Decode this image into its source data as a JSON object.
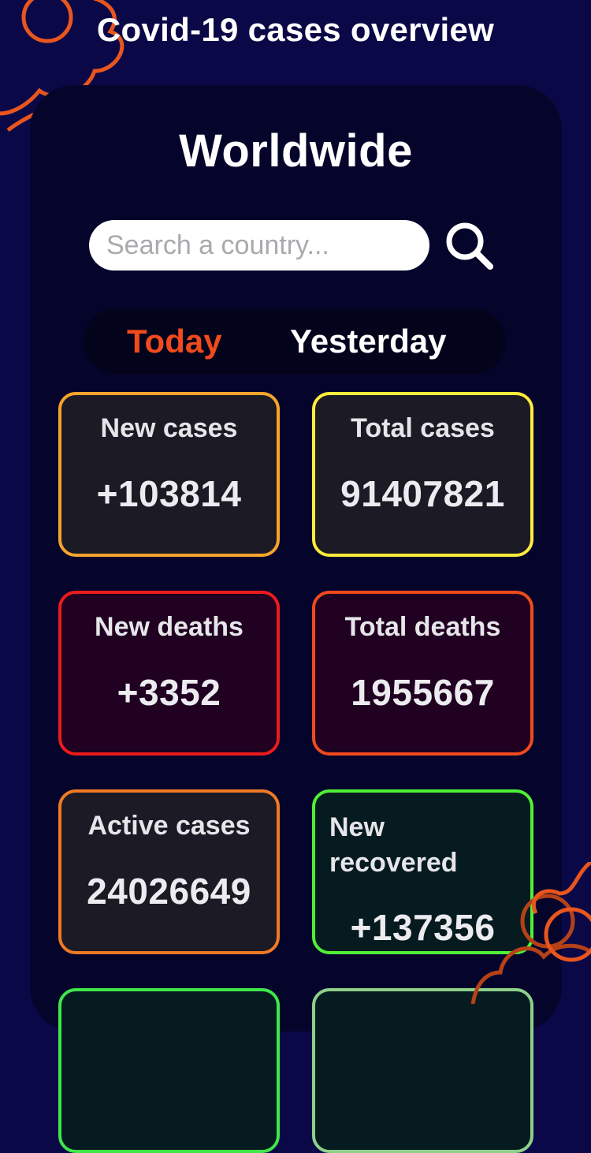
{
  "header": {
    "title": "Covid-19 cases overview"
  },
  "panel": {
    "region_title": "Worldwide"
  },
  "search": {
    "placeholder": "Search a country..."
  },
  "tabs": {
    "today": "Today",
    "yesterday": "Yesterday",
    "active": "today"
  },
  "cards": [
    {
      "label": "New cases",
      "value": "+103814",
      "color": "#f5a52c"
    },
    {
      "label": "Total cases",
      "value": "91407821",
      "color": "#ffeb3b"
    },
    {
      "label": "New deaths",
      "value": "+3352",
      "color": "#ec1b1b"
    },
    {
      "label": "Total deaths",
      "value": "1955667",
      "color": "#f14a1c"
    },
    {
      "label": "Active cases",
      "value": "24026649",
      "color": "#f07a24"
    },
    {
      "label": "New recovered",
      "value": "+137356",
      "color": "#4ff036"
    },
    {
      "label": "",
      "value": "",
      "color": "#3fe64a"
    },
    {
      "label": "",
      "value": "",
      "color": "#8ed08a"
    }
  ],
  "icons": {
    "search": "search-icon",
    "decoration": "virus-icon"
  },
  "colors": {
    "background": "#0b0848",
    "panel": "#05052c",
    "accent": "#f14a1c"
  }
}
